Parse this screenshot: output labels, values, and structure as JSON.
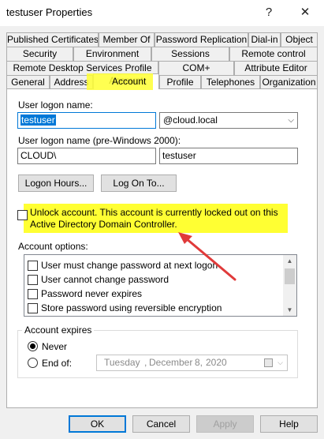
{
  "window": {
    "title": "testuser Properties",
    "help_glyph": "?",
    "close_glyph": "✕"
  },
  "tabs": {
    "row1": [
      "Published Certificates",
      "Member Of",
      "Password Replication",
      "Dial-in",
      "Object"
    ],
    "row2": [
      "Security",
      "Environment",
      "Sessions",
      "Remote control"
    ],
    "row3": [
      "Remote Desktop Services Profile",
      "COM+",
      "Attribute Editor"
    ],
    "row4": [
      "General",
      "Address",
      "Account",
      "Profile",
      "Telephones",
      "Organization"
    ],
    "active": "Account"
  },
  "account": {
    "logon_name_label": "User logon name:",
    "logon_name_value": "testuser",
    "upn_suffix": "@cloud.local",
    "pre2000_label": "User logon name (pre-Windows 2000):",
    "pre2000_domain": "CLOUD\\",
    "pre2000_user": "testuser",
    "logon_hours_button": "Logon Hours...",
    "log_on_to_button": "Log On To...",
    "unlock_text": "Unlock account. This account is currently locked out on this Active Directory Domain Controller.",
    "options_label": "Account options:",
    "options": [
      "User must change password at next logon",
      "User cannot change password",
      "Password never expires",
      "Store password using reversible encryption"
    ],
    "expires_label": "Account expires",
    "never_label": "Never",
    "endof_label": "End of:",
    "expires_selected": "Never",
    "date_weekday": "Tuesday",
    "date_separator": ",",
    "date_month": "December",
    "date_day": "8,",
    "date_year": "2020"
  },
  "footer": {
    "ok": "OK",
    "cancel": "Cancel",
    "apply": "Apply",
    "help": "Help"
  },
  "colors": {
    "highlight": "#ffff33",
    "arrow": "#e03a3a",
    "focus_blue": "#0078d7"
  },
  "icons": {
    "help": "question-mark-icon",
    "close": "close-icon",
    "dropdown": "chevron-down-icon",
    "calendar": "calendar-icon"
  }
}
